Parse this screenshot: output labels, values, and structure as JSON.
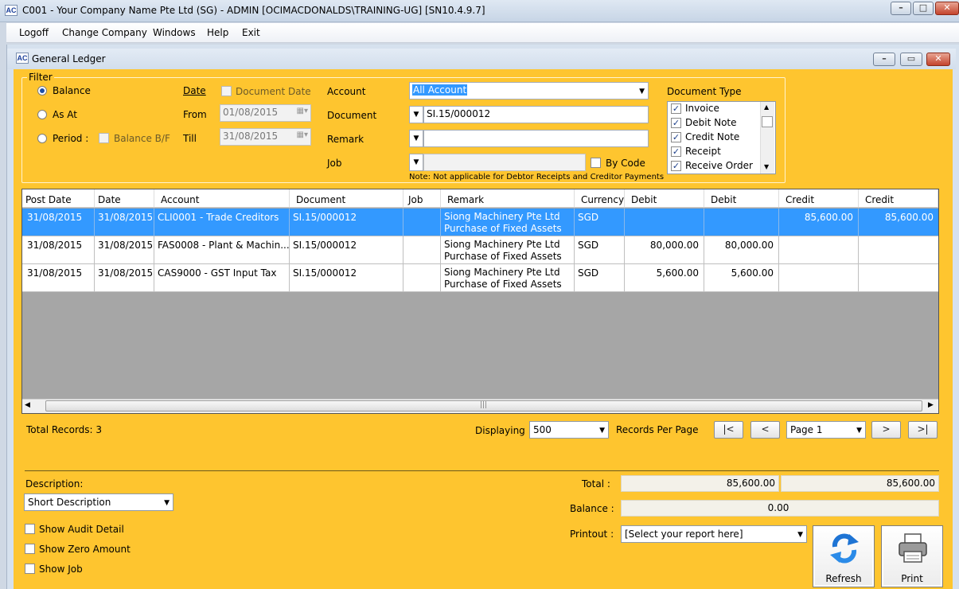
{
  "window": {
    "title": "C001 - Your Company Name Pte Ltd (SG) - ADMIN [OCIMACDONALDS\\TRAINING-UG] [SN10.4.9.7]",
    "icon": "app-logo-icon"
  },
  "menu": [
    "Logoff",
    "Change Company",
    "Windows",
    "Help",
    "Exit"
  ],
  "child_window": {
    "title": "General Ledger"
  },
  "filter": {
    "legend": "Filter",
    "radio_balance": "Balance",
    "radio_as_at": "As At",
    "radio_period": "Period :",
    "balance_bf": "Balance B/F",
    "date_label": "Date",
    "document_date": "Document Date",
    "from_label": "From",
    "from_value": "01/08/2015",
    "till_label": "Till",
    "till_value": "31/08/2015",
    "account_label": "Account",
    "account_value": "All Account",
    "document_label": "Document",
    "document_value": "SI.15/000012",
    "remark_label": "Remark",
    "remark_value": "",
    "job_label": "Job",
    "job_value": "",
    "by_code": "By Code",
    "note": "Note: Not applicable for Debtor Receipts and Creditor Payments",
    "doc_type_label": "Document Type",
    "doc_types": [
      "Invoice",
      "Debit Note",
      "Credit Note",
      "Receipt",
      "Receive Order"
    ]
  },
  "grid": {
    "headers": [
      "Post Date",
      "Date",
      "Account",
      "Document",
      "Job",
      "Remark",
      "Currency",
      "Debit",
      "Debit",
      "Credit",
      "Credit"
    ],
    "rows": [
      {
        "post_date": "31/08/2015",
        "date": "31/08/2015",
        "account": "CLI0001 - Trade Creditors",
        "document": "SI.15/000012",
        "job": "",
        "remark1": "Siong Machinery Pte Ltd",
        "remark2": "Purchase of Fixed Assets",
        "currency": "SGD",
        "debit1": "",
        "debit2": "",
        "credit1": "85,600.00",
        "credit2": "85,600.00"
      },
      {
        "post_date": "31/08/2015",
        "date": "31/08/2015",
        "account": "FAS0008 - Plant & Machin...",
        "document": "SI.15/000012",
        "job": "",
        "remark1": "Siong Machinery Pte Ltd",
        "remark2": "Purchase of Fixed Assets",
        "currency": "SGD",
        "debit1": "80,000.00",
        "debit2": "80,000.00",
        "credit1": "",
        "credit2": ""
      },
      {
        "post_date": "31/08/2015",
        "date": "31/08/2015",
        "account": "CAS9000 - GST Input Tax",
        "document": "SI.15/000012",
        "job": "",
        "remark1": "Siong Machinery Pte Ltd",
        "remark2": "Purchase of Fixed Assets",
        "currency": "SGD",
        "debit1": "5,600.00",
        "debit2": "5,600.00",
        "credit1": "",
        "credit2": ""
      }
    ]
  },
  "paging": {
    "total_records": "Total Records: 3",
    "displaying": "Displaying",
    "per_page_value": "500",
    "records_per_page": "Records Per Page",
    "first": "|<",
    "prev": "<",
    "page_value": "Page 1",
    "next": ">",
    "last": ">|"
  },
  "bottom": {
    "description_label": "Description:",
    "description_value": "Short Description",
    "show_audit": "Show Audit Detail",
    "show_zero": "Show Zero Amount",
    "show_job": "Show Job",
    "total_label": "Total :",
    "total_debit": "85,600.00",
    "total_credit": "85,600.00",
    "balance_label": "Balance :",
    "balance_value": "0.00",
    "printout_label": "Printout :",
    "printout_value": "[Select your report here]",
    "refresh": "Refresh",
    "print": "Print"
  },
  "colors": {
    "panel": "#fec52f",
    "selection": "#3399ff",
    "grid_empty": "#a6a6a6"
  }
}
